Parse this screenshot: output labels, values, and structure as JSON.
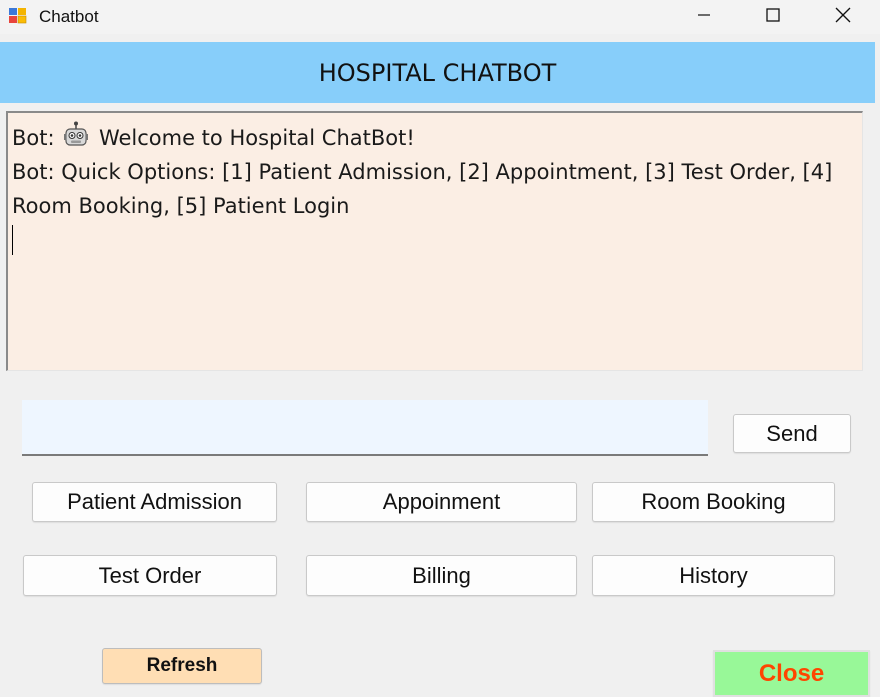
{
  "window": {
    "title": "Chatbot",
    "icons": {
      "app": "app-window-icon",
      "minimize": "minimize-icon",
      "maximize": "maximize-icon",
      "close": "close-icon"
    }
  },
  "header": {
    "title": "HOSPITAL CHATBOT",
    "background": "#87cefa"
  },
  "chat": {
    "background": "#fbeee4",
    "lines": [
      {
        "prefix": "Bot:",
        "icon": "robot-icon",
        "text": "Welcome to Hospital ChatBot!"
      },
      {
        "text": "Bot: Quick Options: [1] Patient Admission, [2] Appointment, [3] Test Order, [4] Room Booking, [5] Patient Login"
      }
    ]
  },
  "input": {
    "value": "",
    "placeholder": "",
    "background": "#eef6ff"
  },
  "buttons": {
    "send": "Send",
    "patient_admission": "Patient Admission",
    "appointment": "Appoinment",
    "room_booking": "Room Booking",
    "test_order": "Test Order",
    "billing": "Billing",
    "history": "History",
    "refresh": "Refresh",
    "close": "Close"
  },
  "colors": {
    "refresh_bg": "#ffdeb4",
    "close_bg": "#98f898",
    "close_text": "#ff4500"
  }
}
